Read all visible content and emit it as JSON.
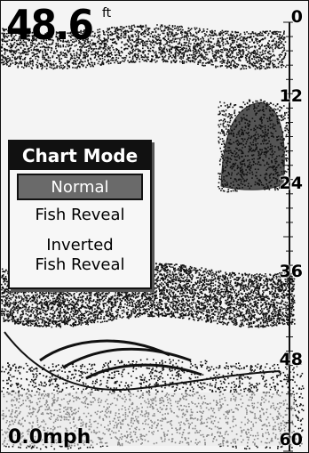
{
  "depth": {
    "value": "48.6",
    "unit": "ft"
  },
  "speed": {
    "value": "0.0mph"
  },
  "depth_scale": {
    "labels": [
      "0",
      "12",
      "24",
      "36",
      "48",
      "60"
    ],
    "min": 0,
    "max": 60
  },
  "chart_mode_menu": {
    "title": "Chart Mode",
    "items": [
      {
        "label": "Normal",
        "selected": true
      },
      {
        "label": "Fish Reveal",
        "selected": false
      },
      {
        "label_line1": "Inverted",
        "label_line2": "Fish Reveal",
        "selected": false
      }
    ]
  },
  "colors": {
    "background": "#f4f4f4",
    "noise": "#111111",
    "menu_selected": "#6a6a6a",
    "menu_title": "#111111"
  }
}
